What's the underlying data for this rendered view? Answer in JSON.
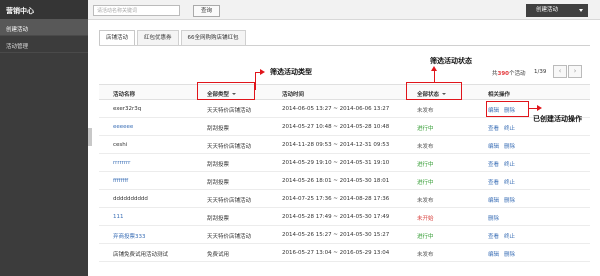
{
  "sidebar": {
    "title": "营销中心",
    "items": [
      {
        "label": "创建活动",
        "active": true
      },
      {
        "label": "活动管理",
        "active": false
      }
    ]
  },
  "topbar": {
    "search_placeholder": "请活动名称关键词",
    "query_label": "查询",
    "create_label": "创建活动"
  },
  "tabs": [
    {
      "label": "店铺活动",
      "active": true
    },
    {
      "label": "红包优惠券",
      "active": false
    },
    {
      "label": "66全网购购店铺红包",
      "active": false
    }
  ],
  "pager": {
    "prefix": "共",
    "total": "390",
    "suffix": "个活动",
    "page": "1/39",
    "prev": "‹",
    "next": "›"
  },
  "table": {
    "headers": {
      "name": "活动名称",
      "type": "全部类型",
      "time": "活动时间",
      "status": "全部状态",
      "ops": "相关操作"
    },
    "rows": [
      {
        "name": "exer32r3q",
        "link": false,
        "type": "天天特价店铺活动",
        "time": "2014-06-05 13:27 ~ 2014-06-06 13:27",
        "status": "未发布",
        "status_color": "gray",
        "ops": [
          "编辑",
          "删除"
        ]
      },
      {
        "name": "eeeeee",
        "link": true,
        "type": "刮刮投票",
        "time": "2014-05-27 10:48 ~ 2014-05-28 10:48",
        "status": "进行中",
        "status_color": "green",
        "ops": [
          "查看",
          "终止"
        ]
      },
      {
        "name": "ceshi",
        "link": false,
        "type": "天天特价店铺活动",
        "time": "2014-11-28 09:53 ~ 2014-12-31 09:53",
        "status": "未发布",
        "status_color": "gray",
        "ops": [
          "编辑",
          "删除"
        ]
      },
      {
        "name": "rrrrrrrr",
        "link": true,
        "type": "刮刮投票",
        "time": "2014-05-29 19:10 ~ 2014-05-31 19:10",
        "status": "进行中",
        "status_color": "green",
        "ops": [
          "查看",
          "终止"
        ]
      },
      {
        "name": "ffffffff",
        "link": true,
        "type": "刮刮投票",
        "time": "2014-05-26 18:01 ~ 2014-05-30 18:01",
        "status": "进行中",
        "status_color": "green",
        "ops": [
          "查看",
          "终止"
        ]
      },
      {
        "name": "dddddddddd",
        "link": false,
        "type": "天天特价店铺活动",
        "time": "2014-07-25 17:36 ~ 2014-08-28 17:36",
        "status": "未发布",
        "status_color": "gray",
        "ops": [
          "编辑",
          "删除"
        ]
      },
      {
        "name": "111",
        "link": true,
        "type": "刮刮投票",
        "time": "2014-05-28 17:49 ~ 2014-05-30 17:49",
        "status": "未开始",
        "status_color": "red",
        "ops": [
          "删除"
        ]
      },
      {
        "name": "弃商投票333",
        "link": true,
        "type": "天天特价店铺活动",
        "time": "2014-05-26 15:27 ~ 2014-05-30 15:27",
        "status": "进行中",
        "status_color": "green",
        "ops": [
          "查看",
          "终止"
        ]
      },
      {
        "name": "店铺免费试用活动测试",
        "link": false,
        "type": "免费试用",
        "time": "2016-05-27 13:04 ~ 2016-05-29 13:04",
        "status": "未发布",
        "status_color": "gray",
        "ops": [
          "编辑",
          "删除"
        ]
      }
    ]
  },
  "annotations": {
    "filter_type": "筛选活动类型",
    "filter_status": "筛选活动状态",
    "created_ops": "已创建活动操作"
  },
  "colors": {
    "sidebar_bg": "#3c3c3c",
    "link": "#3b6fb6",
    "status_green": "#2e9a2e",
    "status_red": "#d9413e",
    "annotation_red": "#e0151b",
    "count_red": "#e4393c"
  }
}
